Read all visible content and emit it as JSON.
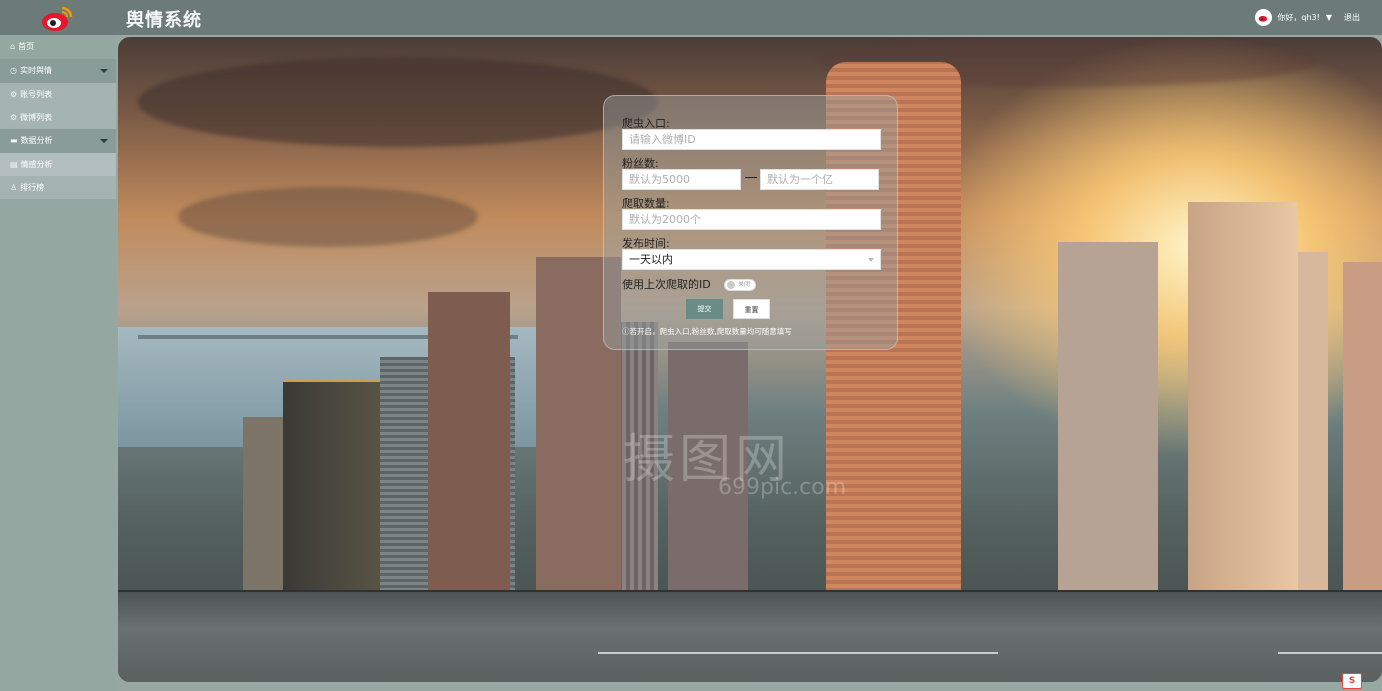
{
  "header": {
    "title": "舆情系统",
    "greeting": "你好，qh3!",
    "logout_label": "退出"
  },
  "sidebar": {
    "items": [
      {
        "label": "首页",
        "icon": "home-icon"
      },
      {
        "label": "实时舆情",
        "icon": "clock-icon"
      },
      {
        "label": "账号列表",
        "icon": "gear-icon"
      },
      {
        "label": "微博列表",
        "icon": "gear-icon"
      },
      {
        "label": "数据分析",
        "icon": "chart-icon"
      },
      {
        "label": "情感分析",
        "icon": "table-icon"
      },
      {
        "label": "排行榜",
        "icon": "user-icon"
      }
    ]
  },
  "form": {
    "entry_label": "爬虫入口:",
    "entry_placeholder": "请输入微博ID",
    "fans_label": "粉丝数:",
    "fans_min_placeholder": "默认为5000",
    "fans_max_placeholder": "默认为一个亿",
    "count_label": "爬取数量:",
    "count_placeholder": "默认为2000个",
    "time_label": "发布时间:",
    "time_selected": "一天以内",
    "reuse_label": "使用上次爬取的ID",
    "toggle_text": "关闭",
    "submit_label": "提交",
    "reset_label": "重置",
    "hint": "ⓘ若开启，爬虫入口,粉丝数,爬取数量均可随意填写"
  },
  "watermark": {
    "text": "摄图网",
    "url": "699pic.com"
  },
  "colors": {
    "topbar": "#6d7b78",
    "sidebar": "#94a7a1",
    "primary_button": "#6b8b86"
  }
}
